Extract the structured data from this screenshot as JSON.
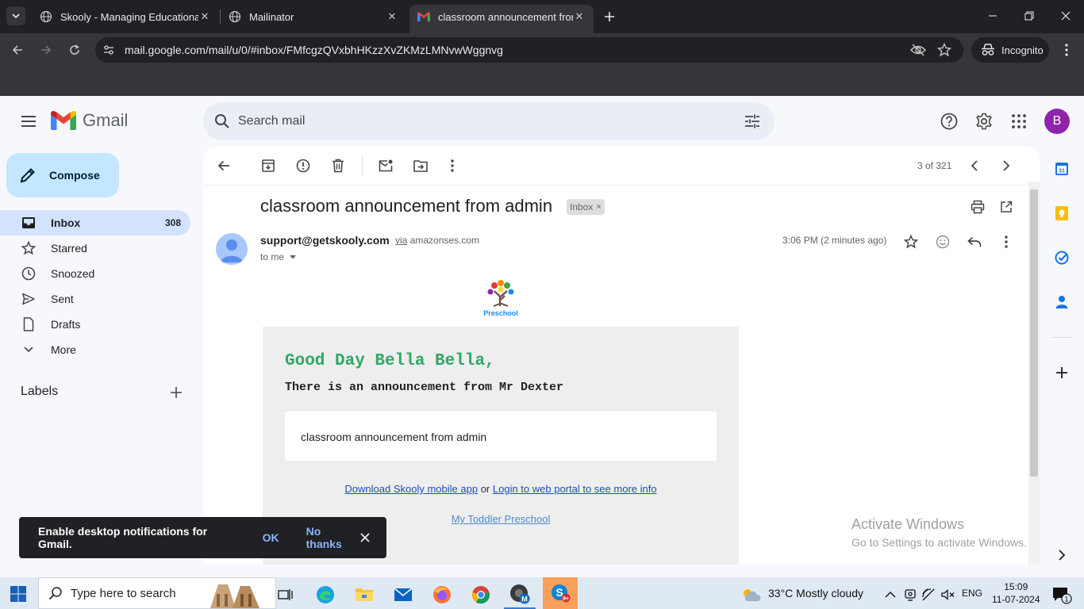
{
  "browser": {
    "tabs": [
      {
        "title": "Skooly - Managing Educational Ins"
      },
      {
        "title": "Mailinator"
      },
      {
        "title": "classroom announcement from adm"
      }
    ],
    "url": "mail.google.com/mail/u/0/#inbox/FMfcgzQVxbhHKzzXvZKMzLMNvwWggnvg",
    "incognito_label": "Incognito"
  },
  "gmail": {
    "brand": "Gmail",
    "search_placeholder": "Search mail",
    "avatar_letter": "B",
    "compose_label": "Compose",
    "nav": [
      {
        "label": "Inbox",
        "count": "308"
      },
      {
        "label": "Starred"
      },
      {
        "label": "Snoozed"
      },
      {
        "label": "Sent"
      },
      {
        "label": "Drafts"
      },
      {
        "label": "More"
      }
    ],
    "labels_heading": "Labels",
    "pager": "3 of 321",
    "message": {
      "subject": "classroom announcement from admin",
      "chip": "Inbox",
      "chip_close": "×",
      "sender": "support@getskooly.com",
      "via_word": "via",
      "via_domain": "amazonses.com",
      "to": "to me",
      "time": "3:06 PM (2 minutes ago)",
      "logo_text": "Preschool",
      "greeting": "Good Day Bella Bella,",
      "announcement": "There is an announcement from Mr Dexter",
      "body": "classroom announcement from admin",
      "link_app": "Download Skooly mobile app",
      "link_or": "or",
      "link_portal": "Login to web portal to see more info",
      "link_school": "My Toddler Preschool"
    },
    "toast": {
      "message": "Enable desktop notifications for Gmail.",
      "ok": "OK",
      "no_thanks": "No thanks"
    }
  },
  "watermark": {
    "line1": "Activate Windows",
    "line2": "Go to Settings to activate Windows."
  },
  "taskbar": {
    "search_placeholder": "Type here to search",
    "weather": "33°C  Mostly cloudy",
    "lang": "ENG",
    "time": "15:09",
    "date": "11-07-2024",
    "notif_count": "1"
  }
}
